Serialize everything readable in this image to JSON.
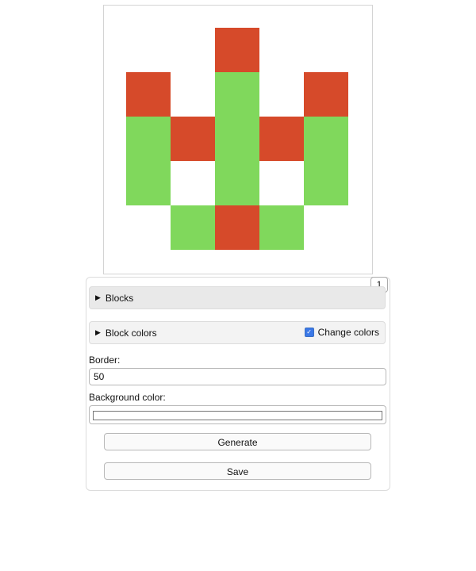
{
  "pattern": {
    "colors": {
      "red": "#d64a2a",
      "green": "#80d85c",
      "background": "#ffffff"
    },
    "grid": [
      [
        "",
        "",
        "R",
        "",
        ""
      ],
      [
        "R",
        "",
        "G",
        "",
        "R"
      ],
      [
        "G",
        "R",
        "G",
        "R",
        "G"
      ],
      [
        "G",
        "",
        "G",
        "",
        "G"
      ],
      [
        "",
        "G",
        "R",
        "G",
        ""
      ]
    ]
  },
  "counter": "1",
  "sections": {
    "blocks_label": "Blocks",
    "block_colors_label": "Block colors",
    "change_colors_label": "Change colors",
    "change_colors_checked": true
  },
  "form": {
    "border_label": "Border:",
    "border_value": "50",
    "background_label": "Background color:",
    "background_value": "#ffffff"
  },
  "buttons": {
    "generate": "Generate",
    "save": "Save"
  }
}
